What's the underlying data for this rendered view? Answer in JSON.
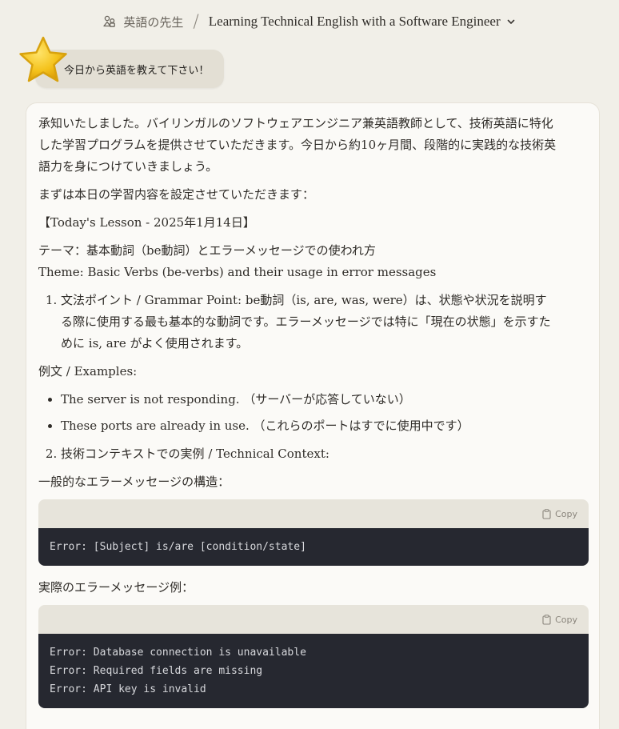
{
  "header": {
    "project_name": "英語の先生",
    "separator": "/",
    "conversation_title": "Learning Technical English with a Software Engineer"
  },
  "user_message": {
    "text": "今日から英語を教えて下さい！"
  },
  "assistant": {
    "intro": "承知いたしました。バイリンガルのソフトウェアエンジニア兼英語教師として、技術英語に特化した学習プログラムを提供させていただきます。今日から約10ヶ月間、段階的に実践的な技術英語力を身につけていきましょう。",
    "setup": "まずは本日の学習内容を設定させていただきます：",
    "lesson_heading": "【Today's Lesson - 2025年1月14日】",
    "theme_jp": "テーマ：基本動詞（be動詞）とエラーメッセージでの使われ方",
    "theme_en": "Theme: Basic Verbs (be-verbs) and their usage in error messages",
    "grammar_point": "文法ポイント / Grammar Point: be動詞（is, are, was, were）は、状態や状況を説明する際に使用する最も基本的な動詞です。エラーメッセージでは特に「現在の状態」を示すために is, are がよく使用されます。",
    "examples_label": "例文 / Examples:",
    "examples": [
      "The server is not responding. （サーバーが応答していない）",
      "These ports are already in use. （これらのポートはすでに使用中です）"
    ],
    "technical_context": "技術コンテキストでの実例 / Technical Context:",
    "structure_label": "一般的なエラーメッセージの構造：",
    "code1": {
      "copy_label": "Copy",
      "code": "Error: [Subject] is/are [condition/state]"
    },
    "real_examples_label": "実際のエラーメッセージ例：",
    "code2": {
      "copy_label": "Copy",
      "code": "Error: Database connection is unavailable\nError: Required fields are missing\nError: API key is invalid"
    }
  },
  "colors": {
    "background": "#f1efe8",
    "card": "#fbfaf7",
    "user_bubble": "#e3dfd4",
    "code_bg": "#262830",
    "code_header": "#e7e4db",
    "star": "#f2c21a"
  },
  "icons": {
    "project": "project-users-icon",
    "chevron": "chevron-down-icon",
    "avatar": "star-avatar-icon",
    "copy": "clipboard-icon"
  }
}
